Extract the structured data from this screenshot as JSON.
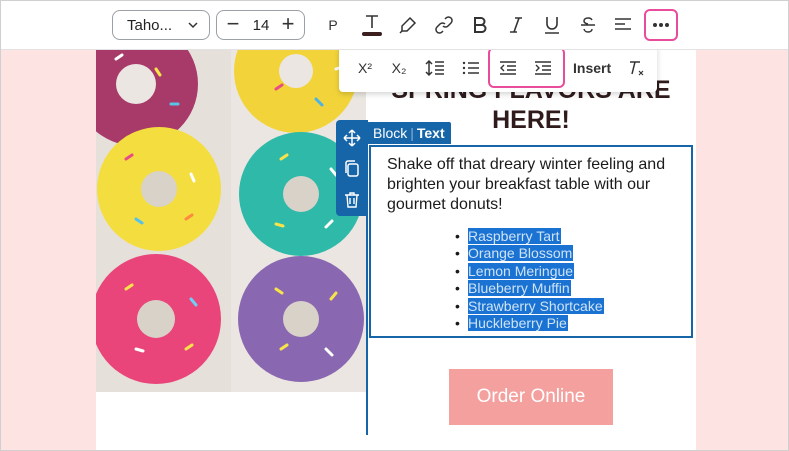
{
  "toolbar": {
    "font_family": "Taho...",
    "font_size": "14",
    "paragraph_label": "P",
    "buttons": [
      "text-color",
      "highlight",
      "link",
      "bold",
      "italic",
      "underline",
      "strikethrough",
      "align",
      "more"
    ]
  },
  "toolbar2": {
    "superscript": "X²",
    "subscript": "X₂",
    "insert_label": "Insert"
  },
  "block_label": {
    "block": "Block",
    "separator": "|",
    "type": "Text"
  },
  "content": {
    "heading_line1": "SPRING FLAVORS ARE",
    "heading_line2": "HERE!",
    "paragraph": "Shake off that dreary winter feeling and brighten your breakfast table with our gourmet donuts!",
    "flavors": [
      "Raspberry Tart",
      "Orange Blossom",
      "Lemon Meringue",
      "Blueberry Muffin",
      "Strawberry Shortcake",
      "Huckleberry Pie"
    ],
    "order_button": "Order Online"
  },
  "colors": {
    "page_background": "#fde3e1",
    "accent_blue": "#1565a8",
    "highlight_pink": "#ea4c9c",
    "order_button": "#f4a09e",
    "selection": "#1a73d2"
  }
}
